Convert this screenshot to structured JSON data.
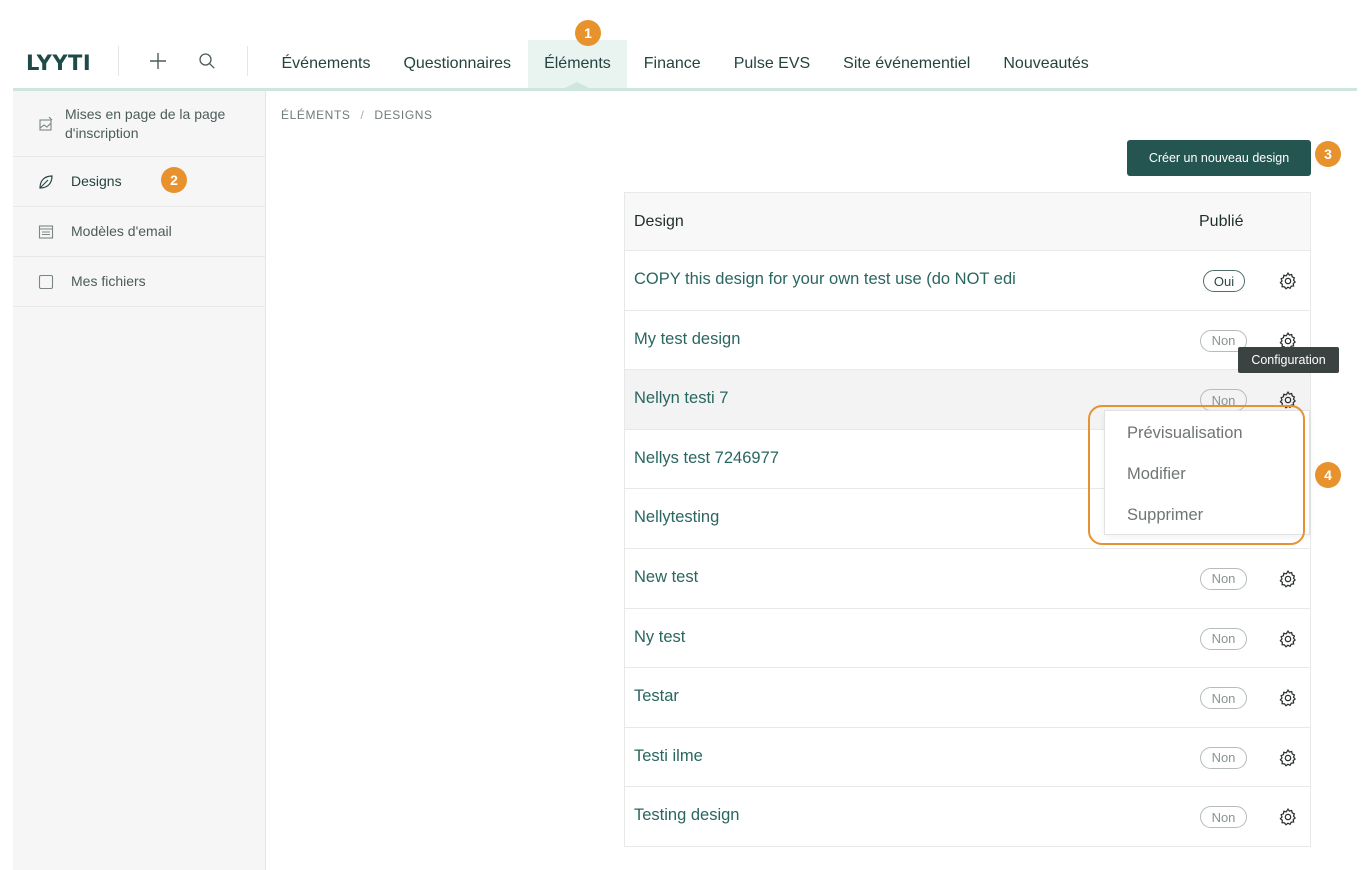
{
  "app": {
    "logo": "LYYTI"
  },
  "header": {
    "nav": [
      {
        "label": "Événements"
      },
      {
        "label": "Questionnaires"
      },
      {
        "label": "Éléments"
      },
      {
        "label": "Finance"
      },
      {
        "label": "Pulse EVS"
      },
      {
        "label": "Site événementiel"
      },
      {
        "label": "Nouveautés"
      }
    ],
    "active_tab": "Éléments",
    "icons": [
      "plus-icon",
      "search-icon"
    ]
  },
  "sidebar": {
    "items": [
      {
        "label": "Mises en page de la page d'inscription",
        "icon": "palette-icon"
      },
      {
        "label": "Designs",
        "icon": "leaf-icon"
      },
      {
        "label": "Modèles d'email",
        "icon": "template-icon"
      },
      {
        "label": "Mes fichiers",
        "icon": "file-icon"
      }
    ],
    "selected": "Designs"
  },
  "breadcrumb": {
    "root": "ÉLÉMENTS",
    "separator": "/",
    "current": "DESIGNS"
  },
  "create_button": "Créer un nouveau design",
  "table": {
    "columns": [
      "Design",
      "Publié"
    ],
    "rows": [
      {
        "name": "COPY this design for your own test use (do NOT edi",
        "published": "Oui"
      },
      {
        "name": "My test design",
        "published": "Non"
      },
      {
        "name": "Nellyn testi 7",
        "published": "Non"
      },
      {
        "name": "Nellys test 7246977",
        "published": ""
      },
      {
        "name": "Nellytesting",
        "published": ""
      },
      {
        "name": "New test",
        "published": "Non"
      },
      {
        "name": "Ny test",
        "published": "Non"
      },
      {
        "name": "Testar",
        "published": "Non"
      },
      {
        "name": "Testi ilme",
        "published": "Non"
      },
      {
        "name": "Testing design",
        "published": "Non"
      }
    ]
  },
  "tooltip": "Configuration",
  "dropdown": {
    "items": [
      "Prévisualisation",
      "Modifier",
      "Supprimer"
    ]
  },
  "markers": [
    "1",
    "2",
    "3",
    "4"
  ],
  "colors": {
    "brand": "#245550",
    "accent": "#e8922e",
    "link": "#2a6660",
    "active_tab_bg": "#e9f4f1"
  }
}
